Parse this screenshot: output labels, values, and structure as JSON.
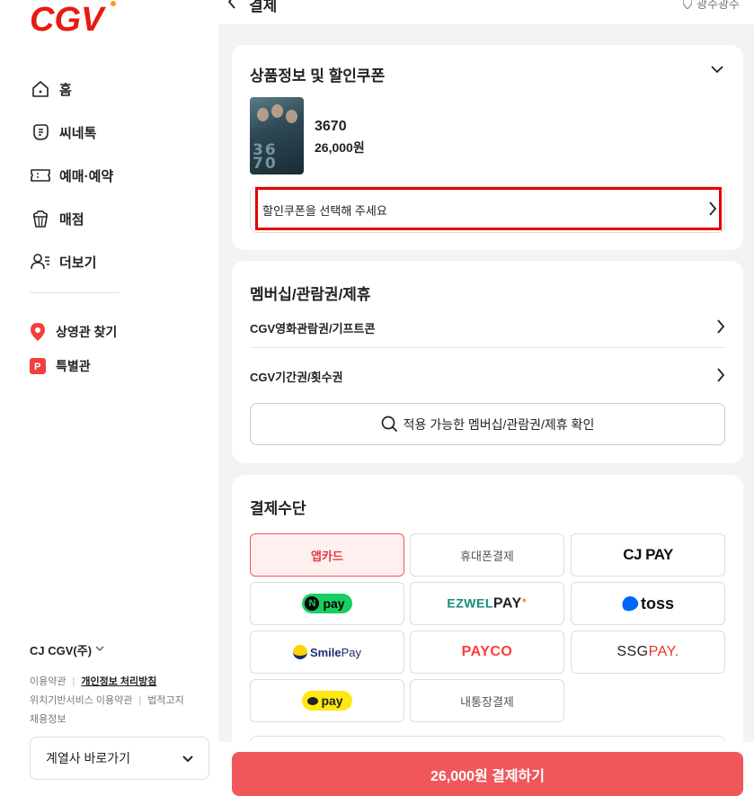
{
  "brand": {
    "logo_text": "CGV",
    "accent": "#f0575b",
    "highlight": "#e60000"
  },
  "sidebar": {
    "nav": [
      {
        "label": "홈",
        "icon": "home-icon"
      },
      {
        "label": "씨네톡",
        "icon": "cinetalk-icon"
      },
      {
        "label": "예매·예약",
        "icon": "ticket-icon"
      },
      {
        "label": "매점",
        "icon": "popcorn-icon"
      },
      {
        "label": "더보기",
        "icon": "more-people-icon"
      }
    ],
    "nav2": [
      {
        "label": "상영관 찾기",
        "icon": "location-pin-icon"
      },
      {
        "label": "특별관",
        "icon": "special-theater-icon"
      }
    ],
    "company": "CJ CGV(주)",
    "footer": {
      "terms": "이용약관",
      "privacy": "개인정보 처리방침",
      "location_terms": "위치기반서비스 이용약관",
      "legal": "법적고지",
      "recruit": "채용정보"
    },
    "affiliate_select": "계열사 바로가기"
  },
  "header": {
    "title": "결제",
    "location": "광주광주"
  },
  "product_card": {
    "title": "상품정보 및 할인쿠폰",
    "product_name": "3670",
    "product_price": "26,000원",
    "poster_text": "36 70",
    "coupon_placeholder": "할인쿠폰을 선택해 주세요"
  },
  "membership_card": {
    "title": "멤버십/관람권/제휴",
    "row1": "CGV영화관람권/기프트콘",
    "row2": "CGV기간권/횟수권",
    "check_button": "적용 가능한 멤버십/관람권/제휴 확인"
  },
  "payment_card": {
    "title": "결제수단",
    "methods": {
      "appcard": "앱카드",
      "phone": "휴대폰결제",
      "cjpay": "CJ PAY",
      "npay_n": "N",
      "npay": "pay",
      "ezwel": "EZWEL",
      "ezwel_pay": "PAY",
      "toss": "toss",
      "smile": "Smile",
      "smile_pay": "Pay",
      "payco": "PAYCO",
      "ssg": "SSG",
      "ssg_pay": "PAY.",
      "kakaopay": "pay",
      "bank": "내통장결제"
    }
  },
  "pay_button": "26,000원 결제하기"
}
